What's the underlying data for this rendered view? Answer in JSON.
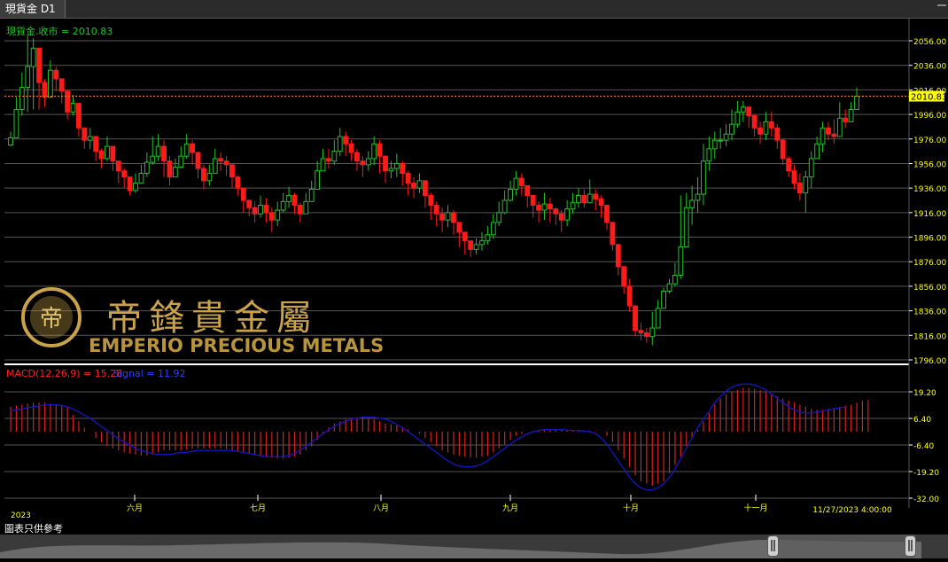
{
  "window": {
    "tab_title": "現貨金 D1"
  },
  "price_panel": {
    "label": "現貨金.收市 = 2010.83",
    "current_price": "2010.83"
  },
  "macd_panel": {
    "label": "MACD(12,26,9) = 15.28",
    "signal_label": "Signal = 11.92"
  },
  "logo": {
    "chinese": "帝鋒貴金屬",
    "english": "EMPERIO PRECIOUS METALS"
  },
  "footer": {
    "disclaimer": "圖表只供參考"
  },
  "colors": {
    "up": "#22c22a",
    "down": "#ff1a1a",
    "macd_hist": "#d42020",
    "signal": "#1515c8",
    "axis_text": "#ffff00",
    "price_line": "#ff8c00"
  },
  "chart_data": [
    {
      "type": "candlestick",
      "title": "現貨金 D1",
      "series_label": "現貨金.收市",
      "last_close": 2010.83,
      "ylim": [
        1790,
        2064
      ],
      "y_ticks": [
        1796.0,
        1816.0,
        1836.0,
        1856.0,
        1876.0,
        1896.0,
        1916.0,
        1936.0,
        1956.0,
        1976.0,
        1996.0,
        2016.0,
        2036.0,
        2056.0
      ],
      "x_labels": [
        "2023",
        "六月",
        "七月",
        "八月",
        "九月",
        "十月",
        "十一月",
        "11/27/2023 4:00:00"
      ],
      "close": [
        1977,
        2000,
        2018,
        2035,
        2050,
        2022,
        2010,
        2032,
        2025,
        2015,
        1998,
        2005,
        1985,
        1975,
        1978,
        1966,
        1960,
        1970,
        1958,
        1950,
        1945,
        1934,
        1940,
        1948,
        1957,
        1962,
        1970,
        1958,
        1945,
        1953,
        1962,
        1972,
        1965,
        1952,
        1942,
        1948,
        1960,
        1958,
        1955,
        1945,
        1936,
        1926,
        1920,
        1915,
        1922,
        1916,
        1910,
        1918,
        1925,
        1930,
        1922,
        1915,
        1925,
        1935,
        1950,
        1960,
        1958,
        1966,
        1978,
        1972,
        1965,
        1958,
        1955,
        1960,
        1972,
        1962,
        1950,
        1952,
        1956,
        1948,
        1940,
        1936,
        1942,
        1930,
        1922,
        1915,
        1910,
        1916,
        1908,
        1900,
        1893,
        1886,
        1890,
        1893,
        1898,
        1908,
        1916,
        1926,
        1935,
        1944,
        1938,
        1930,
        1922,
        1918,
        1923,
        1919,
        1915,
        1910,
        1919,
        1924,
        1930,
        1924,
        1931,
        1927,
        1922,
        1908,
        1890,
        1872,
        1856,
        1840,
        1820,
        1818,
        1815,
        1822,
        1838,
        1852,
        1858,
        1865,
        1888,
        1920,
        1926,
        1931,
        1958,
        1968,
        1975,
        1975,
        1980,
        1988,
        1998,
        2002,
        1995,
        1985,
        1980,
        1990,
        1985,
        1975,
        1960,
        1950,
        1940,
        1932,
        1945,
        1960,
        1972,
        1985,
        1980,
        1978,
        1993,
        1990,
        2000,
        2010.83
      ],
      "high": [
        1982,
        2010,
        2030,
        2060,
        2058,
        2040,
        2025,
        2040,
        2035,
        2025,
        2015,
        2012,
        2000,
        1985,
        1985,
        1975,
        1968,
        1978,
        1965,
        1958,
        1952,
        1945,
        1948,
        1955,
        1965,
        1978,
        1980,
        1975,
        1962,
        1960,
        1970,
        1980,
        1975,
        1965,
        1955,
        1955,
        1968,
        1965,
        1962,
        1955,
        1946,
        1936,
        1926,
        1925,
        1930,
        1928,
        1920,
        1925,
        1932,
        1937,
        1932,
        1924,
        1932,
        1942,
        1958,
        1968,
        1968,
        1975,
        1985,
        1982,
        1975,
        1968,
        1962,
        1966,
        1978,
        1975,
        1962,
        1958,
        1964,
        1958,
        1950,
        1945,
        1948,
        1940,
        1932,
        1925,
        1920,
        1922,
        1918,
        1908,
        1900,
        1892,
        1895,
        1900,
        1905,
        1915,
        1925,
        1934,
        1942,
        1950,
        1948,
        1938,
        1930,
        1925,
        1932,
        1928,
        1920,
        1918,
        1926,
        1932,
        1936,
        1935,
        1943,
        1935,
        1930,
        1922,
        1905,
        1882,
        1870,
        1862,
        1840,
        1826,
        1822,
        1835,
        1845,
        1855,
        1862,
        1875,
        1930,
        1932,
        1938,
        1945,
        1972,
        1978,
        1982,
        1985,
        1988,
        2000,
        2007,
        2007,
        2002,
        1996,
        1990,
        1998,
        1998,
        1988,
        1976,
        1962,
        1955,
        1948,
        1950,
        1966,
        1978,
        1990,
        1990,
        1992,
        2006,
        2000,
        2006,
        2018
      ],
      "low": [
        1970,
        1990,
        1995,
        1998,
        2000,
        2000,
        2002,
        2015,
        2015,
        2005,
        1992,
        1995,
        1978,
        1968,
        1968,
        1958,
        1952,
        1958,
        1950,
        1940,
        1936,
        1930,
        1932,
        1940,
        1945,
        1955,
        1958,
        1945,
        1938,
        1945,
        1952,
        1960,
        1955,
        1944,
        1935,
        1938,
        1952,
        1950,
        1946,
        1936,
        1930,
        1916,
        1913,
        1908,
        1912,
        1908,
        1900,
        1905,
        1916,
        1920,
        1915,
        1908,
        1915,
        1925,
        1942,
        1950,
        1952,
        1955,
        1962,
        1962,
        1958,
        1950,
        1945,
        1950,
        1955,
        1948,
        1940,
        1944,
        1945,
        1938,
        1930,
        1928,
        1932,
        1920,
        1910,
        1905,
        1900,
        1904,
        1898,
        1888,
        1882,
        1880,
        1882,
        1885,
        1890,
        1895,
        1905,
        1915,
        1925,
        1930,
        1930,
        1920,
        1912,
        1908,
        1910,
        1908,
        1906,
        1900,
        1905,
        1915,
        1920,
        1920,
        1925,
        1918,
        1912,
        1902,
        1885,
        1865,
        1850,
        1835,
        1815,
        1812,
        1810,
        1808,
        1835,
        1840,
        1850,
        1856,
        1862,
        1910,
        1906,
        1916,
        1922,
        1950,
        1960,
        1968,
        1970,
        1975,
        1985,
        1990,
        1985,
        1978,
        1972,
        1975,
        1978,
        1968,
        1955,
        1945,
        1935,
        1926,
        1916,
        1936,
        1960,
        1965,
        1975,
        1972,
        1982,
        1985,
        1990,
        2000
      ]
    },
    {
      "type": "line+bar",
      "title": "MACD(12,26,9)",
      "ylim": [
        -36,
        26
      ],
      "y_ticks": [
        -32.0,
        -19.2,
        -6.4,
        6.4,
        19.2
      ],
      "series": [
        {
          "name": "MACD(12,26,9)",
          "last": 15.28,
          "values": [
            12,
            12.5,
            13,
            13.5,
            14,
            14,
            14,
            13.5,
            13,
            12.5,
            12,
            8,
            5,
            2,
            0,
            -3,
            -5,
            -7,
            -8,
            -9,
            -10,
            -10.5,
            -11,
            -11.5,
            -11.5,
            -11,
            -10,
            -9,
            -9,
            -9,
            -9,
            -8.5,
            -8,
            -8,
            -8,
            -8,
            -8,
            -8,
            -8.5,
            -9,
            -9.5,
            -10,
            -10.5,
            -11,
            -11.5,
            -12,
            -12.5,
            -13,
            -13,
            -12.5,
            -12,
            -11,
            -9,
            -7,
            -4,
            -1,
            2,
            4,
            5,
            6,
            6.5,
            7,
            7,
            6.5,
            6,
            5,
            4,
            3.5,
            3,
            2,
            1,
            0,
            -1,
            -3,
            -5,
            -7,
            -9,
            -10,
            -11,
            -11.5,
            -12,
            -12.5,
            -12.5,
            -12,
            -11.5,
            -10,
            -8,
            -6,
            -4,
            -2,
            -1,
            0,
            0.5,
            1,
            1,
            1,
            1,
            1,
            0.5,
            0.5,
            0.5,
            0.5,
            0.5,
            0.3,
            0,
            -2,
            -5,
            -9,
            -13,
            -17,
            -21,
            -24,
            -25,
            -26,
            -25,
            -24,
            -20,
            -16,
            -12,
            -7,
            -3,
            1,
            5,
            9,
            13,
            16,
            18,
            19,
            20,
            21,
            21,
            20.5,
            20,
            19,
            18,
            17,
            16,
            15,
            14,
            13,
            12,
            11,
            10.5,
            10.5,
            11,
            11.5,
            12,
            12.5,
            13,
            14,
            15,
            15.28
          ]
        },
        {
          "name": "Signal",
          "last": 11.92,
          "values": [
            10,
            10.5,
            11,
            11.5,
            12,
            12.5,
            12.8,
            13,
            13,
            12.5,
            12,
            11,
            9.5,
            8,
            6.5,
            4.5,
            2.5,
            0.5,
            -1.5,
            -3.5,
            -5,
            -6.5,
            -8,
            -9,
            -10,
            -10.5,
            -11,
            -11,
            -11,
            -10.5,
            -10,
            -10,
            -9.5,
            -9,
            -9,
            -9,
            -9,
            -9,
            -9,
            -9,
            -9.5,
            -10,
            -10.5,
            -11,
            -11.5,
            -12,
            -12,
            -12,
            -12,
            -11.5,
            -10.5,
            -9,
            -7,
            -5,
            -3,
            -1,
            1,
            2.5,
            4,
            5,
            6,
            6.5,
            7,
            7,
            7,
            6.5,
            6,
            5,
            3.5,
            2,
            0,
            -2,
            -4,
            -6,
            -8,
            -10,
            -12,
            -14,
            -15.5,
            -16.5,
            -17,
            -17,
            -16.5,
            -15.5,
            -14,
            -12,
            -10,
            -8,
            -6,
            -4,
            -2.5,
            -1,
            0,
            0.5,
            1,
            1,
            1,
            1,
            0.8,
            0.6,
            0.5,
            0.3,
            0,
            -1,
            -3,
            -6,
            -10,
            -14,
            -18,
            -22,
            -25,
            -27,
            -28,
            -28,
            -27,
            -25,
            -22,
            -18,
            -13,
            -8,
            -3,
            2,
            6,
            10,
            14,
            17,
            19.5,
            21.5,
            22.5,
            23,
            23,
            22.5,
            21.5,
            20,
            18,
            16,
            14,
            12,
            10.5,
            9.5,
            9,
            9,
            9.5,
            10,
            10.5,
            11,
            11.5,
            11.92
          ]
        }
      ]
    }
  ]
}
